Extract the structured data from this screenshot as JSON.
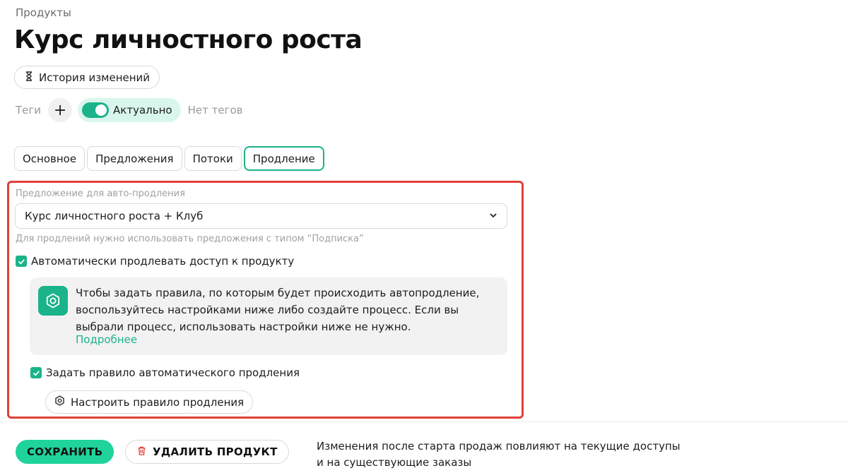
{
  "breadcrumb": "Продукты",
  "title": "Курс личностного роста",
  "history_button": {
    "label": "История изменений",
    "icon": "hourglass-icon"
  },
  "tags": {
    "label": "Теги",
    "add_icon": "+",
    "status_label": "Актуально",
    "status_toggle_on": true,
    "empty_text": "Нет тегов"
  },
  "tabs": [
    {
      "label": "Основное",
      "active": false
    },
    {
      "label": "Предложения",
      "active": false
    },
    {
      "label": "Потоки",
      "active": false
    },
    {
      "label": "Продление",
      "active": true
    }
  ],
  "renewal": {
    "field_label": "Предложение для авто-продления",
    "selected_offer": "Курс личностного роста + Клуб",
    "hint": "Для продлений нужно использовать предложения с типом “Подписка”",
    "auto_renew_checkbox": {
      "label": "Автоматически продлевать доступ к продукту",
      "checked": true
    },
    "info": {
      "text": "Чтобы задать правила, по которым будет происходить автопродление, воспользуйтесь настройками ниже либо создайте процесс. Если вы выбрали процесс, использовать настройки ниже не нужно.",
      "link": "Подробнее"
    },
    "rule_checkbox": {
      "label": "Задать правило автоматического продления",
      "checked": true
    },
    "config_button": "Настроить правило продления"
  },
  "footer": {
    "save_label": "СОХРАНИТЬ",
    "delete_label": "УДАЛИТЬ ПРОДУКТ",
    "note_line1": "Изменения после старта продаж повлияют на текущие доступы",
    "note_line2": "и на существующие заказы"
  },
  "colors": {
    "accent": "#1bb38a",
    "save": "#1fd399",
    "highlight": "#e0403a",
    "status_bg": "#d9f6ec"
  }
}
